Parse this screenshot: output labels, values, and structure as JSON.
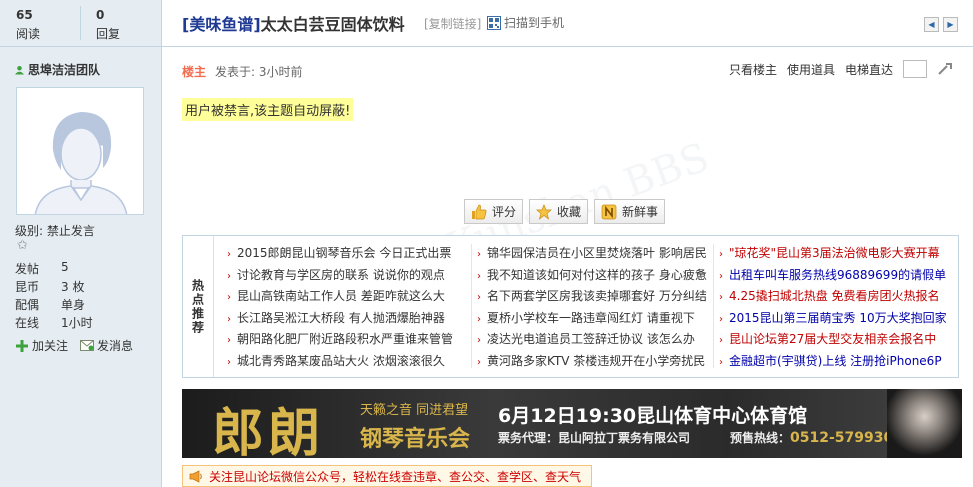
{
  "stats": {
    "read_count": "65",
    "read_label": "阅读",
    "reply_count": "0",
    "reply_label": "回复"
  },
  "thread": {
    "title_tag": "[美味鱼谱]",
    "title_text": "太太白芸豆固体饮料",
    "copy_link": "[复制链接]",
    "scan_to_phone": "扫描到手机"
  },
  "user": {
    "name": "思埠洁洁团队",
    "level": "级别: 禁止发言",
    "fields": [
      {
        "k": "发帖",
        "v": "5"
      },
      {
        "k": "昆币",
        "v": "3 枚"
      },
      {
        "k": "配偶",
        "v": "单身"
      },
      {
        "k": "在线",
        "v": "1小时"
      }
    ],
    "follow": "加关注",
    "message": "发消息"
  },
  "post": {
    "author_badge": "楼主",
    "time": "发表于: 3小时前",
    "only_author": "只看楼主",
    "use_tool": "使用道具",
    "elevator": "电梯直达",
    "banned_text": "用户被禁言,该主题自动屏蔽!"
  },
  "buttons": {
    "rate": "评分",
    "favorite": "收藏",
    "fresh": "新鲜事"
  },
  "hot": {
    "label": "热点推荐",
    "col1": [
      "2015郎朗昆山钢琴音乐会 今日正式出票",
      "讨论教育与学区房的联系 说说你的观点",
      "昆山高铁南站工作人员 差距咋就这么大",
      "长江路吴淞江大桥段 有人抛洒爆胎神器",
      "朝阳路化肥厂附近路段积水严重谁来管管",
      "城北青秀路某废品站大火 浓烟滚滚很久"
    ],
    "col2": [
      "锦华园保洁员在小区里焚烧落叶 影响居民",
      "我不知道该如何对付这样的孩子 身心疲惫",
      "名下两套学区房我该卖掉哪套好 万分纠结",
      "夏桥小学校车一路违章闯红灯 请重视下",
      "凌达光电道追员工签辞迁协议 该怎么办",
      "黄河路多家KTV 茶楼违规开在小学旁扰民"
    ],
    "col3": [
      "\"琼花奖\"昆山第3届法治微电影大赛开幕",
      "出租车叫车服务热线96889699的请假单",
      "4.25撬扫城北热盘 免费看房团火热报名",
      "2015昆山第三届萌宝秀 10万大奖抱回家",
      "昆山论坛第27届大型交友相亲会报名中",
      "金融超市(宇骐贷)上线 注册抢iPhone6P"
    ],
    "col3_colors": [
      "#c00000",
      "#0000aa",
      "#c00000",
      "#0000aa",
      "#c00000",
      "#0000aa"
    ]
  },
  "banner": {
    "brand": "郎朗",
    "sub1": "天籁之音 同进君望",
    "sub2": "钢琴音乐会",
    "date": "6月12日19:30昆山体育中心体育馆",
    "ticket": "票务代理：昆山阿拉丁票务有限公司",
    "phone_label": "预售热线：",
    "phone": "0512-57993030"
  },
  "notice": {
    "text": "关注昆山论坛微信公众号，轻松在线查违章、查公交、查学区、查天气"
  }
}
